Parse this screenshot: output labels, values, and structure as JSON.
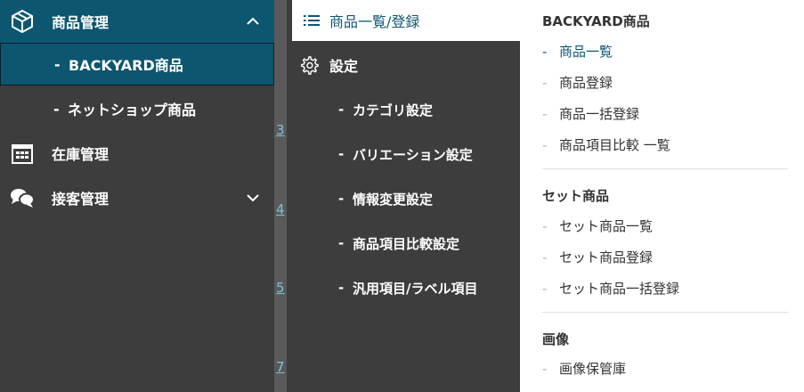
{
  "sidebar": {
    "product_mgmt": "商品管理",
    "backyard": "BACKYARD商品",
    "netshop": "ネットショップ商品",
    "stock_mgmt": "在庫管理",
    "customer_mgmt": "接客管理",
    "dash": "-"
  },
  "strip": {
    "numbers": [
      "3",
      "4",
      "5",
      "7"
    ]
  },
  "submenu": {
    "header": "商品一覧/登録",
    "settings": "設定",
    "items": [
      "カテゴリ設定",
      "バリエーション設定",
      "情報変更設定",
      "商品項目比較設定",
      "汎用項目/ラベル項目"
    ]
  },
  "panel": {
    "sections": [
      {
        "title": "BACKYARD商品",
        "links": [
          "商品一覧",
          "商品登録",
          "商品一括登録",
          "商品項目比較 一覧"
        ]
      },
      {
        "title": "セット商品",
        "links": [
          "セット商品一覧",
          "セット商品登録",
          "セット商品一括登録"
        ]
      },
      {
        "title": "画像",
        "links": [
          "画像保管庫"
        ]
      }
    ]
  },
  "colors": {
    "accent": "#0d5670",
    "sidebar_bg": "#3d3d3d",
    "panel_bg": "#ffffff"
  }
}
